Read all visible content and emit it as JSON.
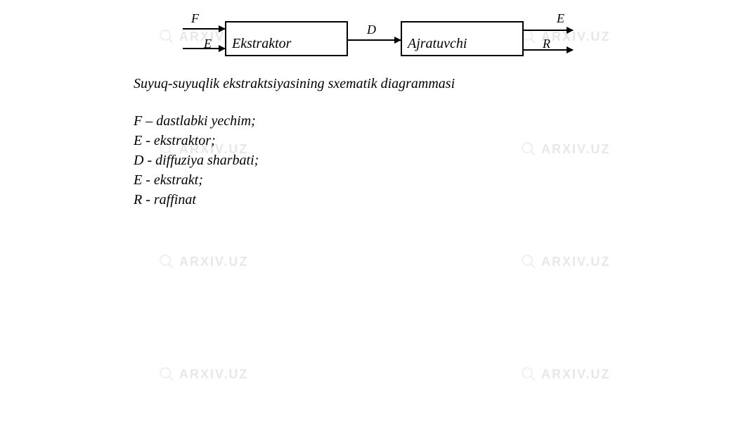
{
  "watermark": {
    "text": "ARXIV.UZ"
  },
  "diagram": {
    "box1_label": "Ekstraktor",
    "box2_label": "Ajratuvchi",
    "arrows": {
      "f": "F",
      "e_in": "E",
      "d": "D",
      "e_out": "E",
      "r": "R"
    }
  },
  "caption": "Suyuq-suyuqlik ekstraktsiyasining sxematik diagrammasi",
  "legend": {
    "line1": "F – dastlabki yechim;",
    "line2": "E - ekstraktor;",
    "line3": "D - diffuziya sharbati;",
    "line4": "E - ekstrakt;",
    "line5": "R - raffinat"
  },
  "chart_data": {
    "type": "diagram",
    "description": "Block flow diagram of liquid-liquid extraction",
    "blocks": [
      {
        "id": "ekstraktor",
        "label": "Ekstraktor"
      },
      {
        "id": "ajratuvchi",
        "label": "Ajratuvchi"
      }
    ],
    "flows": [
      {
        "label": "F",
        "from": "input",
        "to": "ekstraktor",
        "meaning": "dastlabki yechim"
      },
      {
        "label": "E",
        "from": "input",
        "to": "ekstraktor",
        "meaning": "ekstraktor"
      },
      {
        "label": "D",
        "from": "ekstraktor",
        "to": "ajratuvchi",
        "meaning": "diffuziya sharbati"
      },
      {
        "label": "E",
        "from": "ajratuvchi",
        "to": "output",
        "meaning": "ekstrakt"
      },
      {
        "label": "R",
        "from": "ajratuvchi",
        "to": "output",
        "meaning": "raffinat"
      }
    ]
  }
}
